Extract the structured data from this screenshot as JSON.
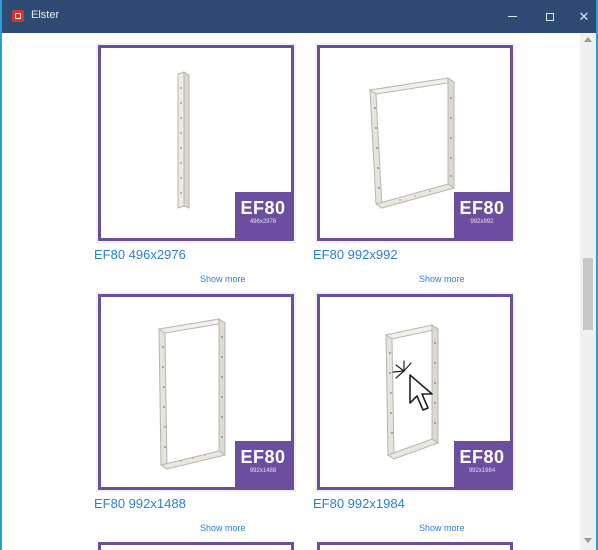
{
  "window": {
    "title": "Elster",
    "controls": {
      "minimize": "–",
      "maximize": "□",
      "close": "✕"
    }
  },
  "products": [
    {
      "title": "EF80 496x2976",
      "badge": "EF80",
      "badge_sub": "496x2976",
      "link": "Show more",
      "shape": "narrow-rail"
    },
    {
      "title": "EF80 992x992",
      "badge": "EF80",
      "badge_sub": "992x992",
      "link": "Show more",
      "shape": "square-frame"
    },
    {
      "title": "EF80 992x1488",
      "badge": "EF80",
      "badge_sub": "992x1488",
      "link": "Show more",
      "shape": "tall-frame"
    },
    {
      "title": "EF80 992x1984",
      "badge": "EF80",
      "badge_sub": "992x1984",
      "link": "Show more",
      "shape": "taller-frame"
    }
  ],
  "colors": {
    "accent": "#6c4ea0",
    "link": "#2b7de0",
    "titlebar": "#2c4a72",
    "window_border": "#2a9fd6"
  }
}
